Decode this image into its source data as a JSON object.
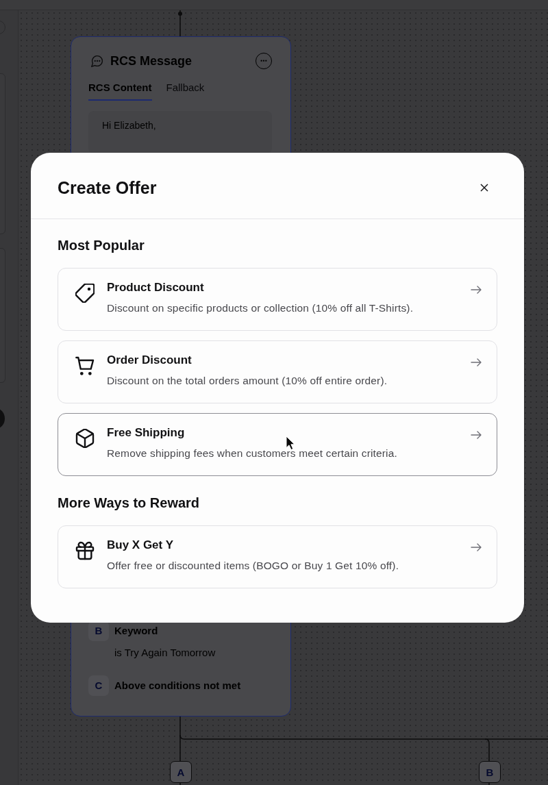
{
  "canvas": {
    "node": {
      "title": "RCS Message",
      "selected": true,
      "tabs": [
        {
          "label": "RCS Content",
          "selected": true
        },
        {
          "label": "Fallback",
          "selected": false
        }
      ],
      "message": [
        "Hi Elizabeth,"
      ],
      "conditions": [
        {
          "badge": "B",
          "title": "Keyword",
          "detail": "is Try Again Tomorrow"
        },
        {
          "badge": "C",
          "title": "Above conditions not met"
        }
      ]
    },
    "branches": [
      "A",
      "B"
    ]
  },
  "modal": {
    "title": "Create Offer",
    "sections": [
      {
        "heading": "Most Popular",
        "options": [
          {
            "title": "Product Discount",
            "description": "Discount on specific products or collection (10% off all T-Shirts).",
            "hovered": false
          },
          {
            "title": "Order Discount",
            "description": "Discount on the total orders amount (10% off entire order).",
            "hovered": false
          },
          {
            "title": "Free Shipping",
            "description": "Remove shipping fees when customers meet certain criteria.",
            "hovered": true
          }
        ]
      },
      {
        "heading": "More Ways to Reward",
        "options": [
          {
            "title": "Buy X Get Y",
            "description": "Offer free or discounted items (BOGO or Buy 1 Get 10% off).",
            "hovered": false
          }
        ]
      }
    ]
  }
}
